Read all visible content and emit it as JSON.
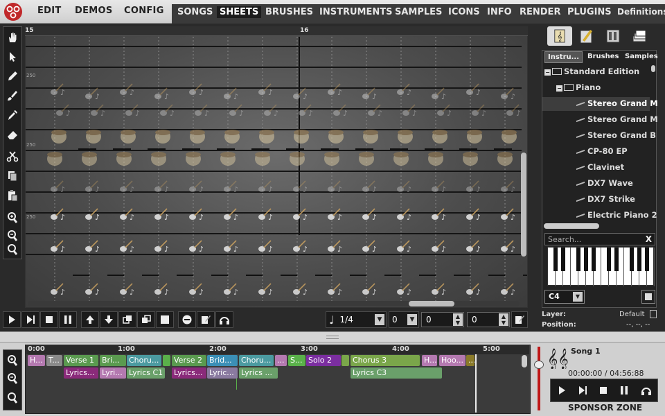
{
  "menu": {
    "items": [
      "EDIT",
      "DEMOS",
      "CONFIG"
    ]
  },
  "tabs": [
    "SONGS",
    "SHEETS",
    "BRUSHES",
    "INSTRUMENTS",
    "SAMPLES",
    "ICONS",
    "INFO",
    "RENDER",
    "PLUGINS",
    "Definitions"
  ],
  "active_tab": "SHEETS",
  "ruler": {
    "left_label": "15",
    "right_label": "16"
  },
  "sheet_row_labels": {
    "row4": "250",
    "row6": "250",
    "row11": "250"
  },
  "transport": {
    "duration_value": "1/4",
    "fields": [
      "0",
      "0",
      "0"
    ]
  },
  "right_panel": {
    "tabs": [
      "Instru...",
      "Brushes",
      "Samples"
    ],
    "tree": [
      {
        "label": "Standard Edition",
        "level": 0,
        "icon": "folder-open-icon"
      },
      {
        "label": "Piano",
        "level": 1,
        "icon": "folder-open-icon"
      },
      {
        "label": "Stereo Grand M",
        "level": 2,
        "icon": "grand-piano-icon",
        "selected": true
      },
      {
        "label": "Stereo Grand M",
        "level": 2,
        "icon": "grand-piano-icon"
      },
      {
        "label": "Stereo Grand B",
        "level": 2,
        "icon": "grand-piano-icon"
      },
      {
        "label": "CP-80 EP",
        "level": 2,
        "icon": "keyboard-icon"
      },
      {
        "label": "Clavinet",
        "level": 2,
        "icon": "keyboard-icon"
      },
      {
        "label": "DX7 Wave",
        "level": 2,
        "icon": "keyboard-icon"
      },
      {
        "label": "DX7 Strike",
        "level": 2,
        "icon": "keyboard-icon"
      },
      {
        "label": "Electric Piano 2",
        "level": 2,
        "icon": "keyboard-icon"
      }
    ],
    "search_placeholder": "Search...",
    "search_clear": "X",
    "note_select": "C4",
    "layer_label": "Layer:",
    "layer_value": "Default",
    "position_label": "Position:",
    "position_value": "--, --, --"
  },
  "song": {
    "ruler": [
      "0:00",
      "1:00",
      "2:00",
      "3:00",
      "4:00",
      "5:00"
    ],
    "track1": [
      {
        "label": "H...",
        "color": "#b479b0"
      },
      {
        "label": "T...",
        "color": "#8a8a8a"
      },
      {
        "label": "Verse 1",
        "color": "#5a9a4f"
      },
      {
        "label": "Bri...",
        "color": "#5a9a4f"
      },
      {
        "label": "Choru...",
        "color": "#4b9aa0"
      },
      {
        "label": "",
        "color": "#5ab04a"
      },
      {
        "label": "Verse 2",
        "color": "#5a9a4f"
      },
      {
        "label": "Brid...",
        "color": "#3b8fb6"
      },
      {
        "label": "Choru...",
        "color": "#4b9aa0"
      },
      {
        "label": "...",
        "color": "#b479b0"
      },
      {
        "label": "S...",
        "color": "#5ab04a"
      },
      {
        "label": "Solo 2",
        "color": "#7b2ea0"
      },
      {
        "label": "",
        "color": "#7aa64a"
      },
      {
        "label": "Chorus 3",
        "color": "#7aa64a"
      },
      {
        "label": "H...",
        "color": "#b479b0"
      },
      {
        "label": "Hoo...",
        "color": "#b479b0"
      },
      {
        "label": "...",
        "color": "#8a7a2a"
      }
    ],
    "track2": [
      {
        "label": "Lyrics...",
        "color": "#8a2a7a"
      },
      {
        "label": "Lyri...",
        "color": "#b479b0"
      },
      {
        "label": "Lyrics C1",
        "color": "#6aa06a"
      },
      {
        "label": "Lyrics...",
        "color": "#8a2a7a"
      },
      {
        "label": "Lyric...",
        "color": "#8a7aa0"
      },
      {
        "label": "Lyrics ...",
        "color": "#6aa06a"
      },
      {
        "label": "Lyrics C3",
        "color": "#6aa06a"
      }
    ],
    "name": "Song 1",
    "time_current": "00:00:00",
    "time_total": "04:56:88",
    "time_sep": " / ",
    "sponsor": "SPONSOR ZONE"
  }
}
